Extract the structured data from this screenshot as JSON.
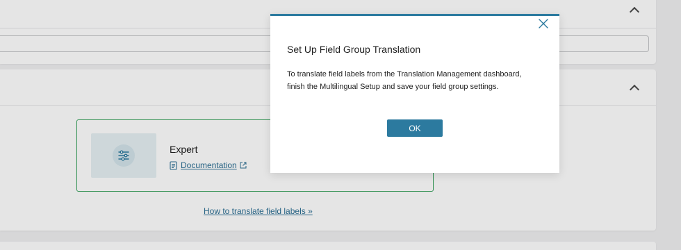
{
  "background": {
    "expert_card": {
      "title": "Expert",
      "documentation_link": "Documentation",
      "thumbnail_icon": "sliders-icon",
      "external_icon": "external-link-icon"
    },
    "how_to_link": "How to translate field labels »"
  },
  "modal": {
    "title": "Set Up Field Group Translation",
    "body_line_1": "To translate field labels from the Translation Management dashboard,",
    "body_line_2": "finish the Multilingual Setup and save your field group settings.",
    "ok_label": "OK",
    "close_icon": "close-icon"
  },
  "colors": {
    "accent": "#2c7a9f",
    "link": "#2c6f94",
    "card_border": "#35a15a",
    "page_bg": "#f0f0f1"
  }
}
